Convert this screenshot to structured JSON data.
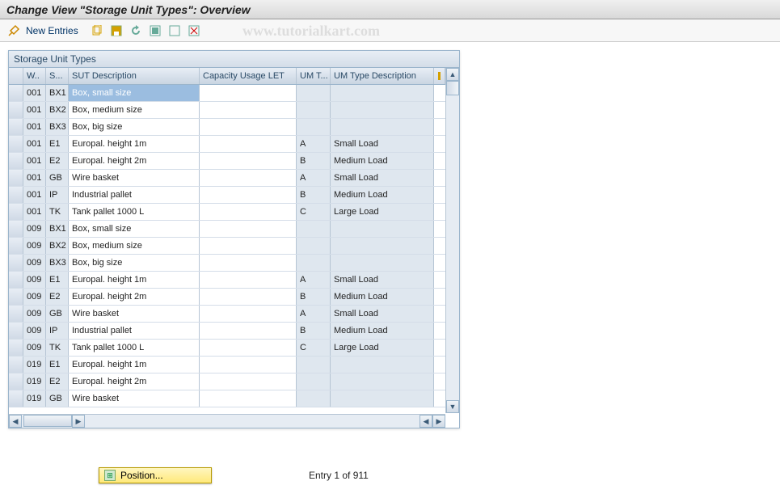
{
  "header": {
    "title": "Change View \"Storage Unit Types\": Overview"
  },
  "toolbar": {
    "new_entries": "New Entries"
  },
  "watermark": "www.tutorialkart.com",
  "panel": {
    "title": "Storage Unit Types",
    "columns": {
      "w": "W..",
      "s": "S...",
      "desc": "SUT Description",
      "cap": "Capacity Usage LET",
      "umt": "UM T...",
      "umd": "UM Type Description"
    }
  },
  "rows": [
    {
      "w": "001",
      "s": "BX1",
      "desc": "Box, small size",
      "cap": "",
      "umt": "",
      "umd": "",
      "sel": true
    },
    {
      "w": "001",
      "s": "BX2",
      "desc": "Box, medium size",
      "cap": "",
      "umt": "",
      "umd": ""
    },
    {
      "w": "001",
      "s": "BX3",
      "desc": "Box, big size",
      "cap": "",
      "umt": "",
      "umd": ""
    },
    {
      "w": "001",
      "s": "E1",
      "desc": "Europal. height 1m",
      "cap": "",
      "umt": "A",
      "umd": "Small Load"
    },
    {
      "w": "001",
      "s": "E2",
      "desc": "Europal. height 2m",
      "cap": "",
      "umt": "B",
      "umd": "Medium Load"
    },
    {
      "w": "001",
      "s": "GB",
      "desc": "Wire basket",
      "cap": "",
      "umt": "A",
      "umd": "Small Load"
    },
    {
      "w": "001",
      "s": "IP",
      "desc": "Industrial pallet",
      "cap": "",
      "umt": "B",
      "umd": "Medium Load"
    },
    {
      "w": "001",
      "s": "TK",
      "desc": "Tank pallet 1000 L",
      "cap": "",
      "umt": "C",
      "umd": "Large Load"
    },
    {
      "w": "009",
      "s": "BX1",
      "desc": "Box, small size",
      "cap": "",
      "umt": "",
      "umd": ""
    },
    {
      "w": "009",
      "s": "BX2",
      "desc": "Box, medium size",
      "cap": "",
      "umt": "",
      "umd": ""
    },
    {
      "w": "009",
      "s": "BX3",
      "desc": "Box, big size",
      "cap": "",
      "umt": "",
      "umd": ""
    },
    {
      "w": "009",
      "s": "E1",
      "desc": "Europal. height 1m",
      "cap": "",
      "umt": "A",
      "umd": "Small Load"
    },
    {
      "w": "009",
      "s": "E2",
      "desc": "Europal. height 2m",
      "cap": "",
      "umt": "B",
      "umd": "Medium Load"
    },
    {
      "w": "009",
      "s": "GB",
      "desc": "Wire basket",
      "cap": "",
      "umt": "A",
      "umd": "Small Load"
    },
    {
      "w": "009",
      "s": "IP",
      "desc": "Industrial pallet",
      "cap": "",
      "umt": "B",
      "umd": "Medium Load"
    },
    {
      "w": "009",
      "s": "TK",
      "desc": "Tank pallet 1000 L",
      "cap": "",
      "umt": "C",
      "umd": "Large Load"
    },
    {
      "w": "019",
      "s": "E1",
      "desc": "Europal. height 1m",
      "cap": "",
      "umt": "",
      "umd": ""
    },
    {
      "w": "019",
      "s": "E2",
      "desc": "Europal. height 2m",
      "cap": "",
      "umt": "",
      "umd": ""
    },
    {
      "w": "019",
      "s": "GB",
      "desc": "Wire basket",
      "cap": "",
      "umt": "",
      "umd": ""
    }
  ],
  "footer": {
    "position_label": "Position...",
    "entry_info": "Entry 1 of 911"
  },
  "colors": {
    "border": "#9bb5cc",
    "shaded": "#dfe7ef"
  }
}
